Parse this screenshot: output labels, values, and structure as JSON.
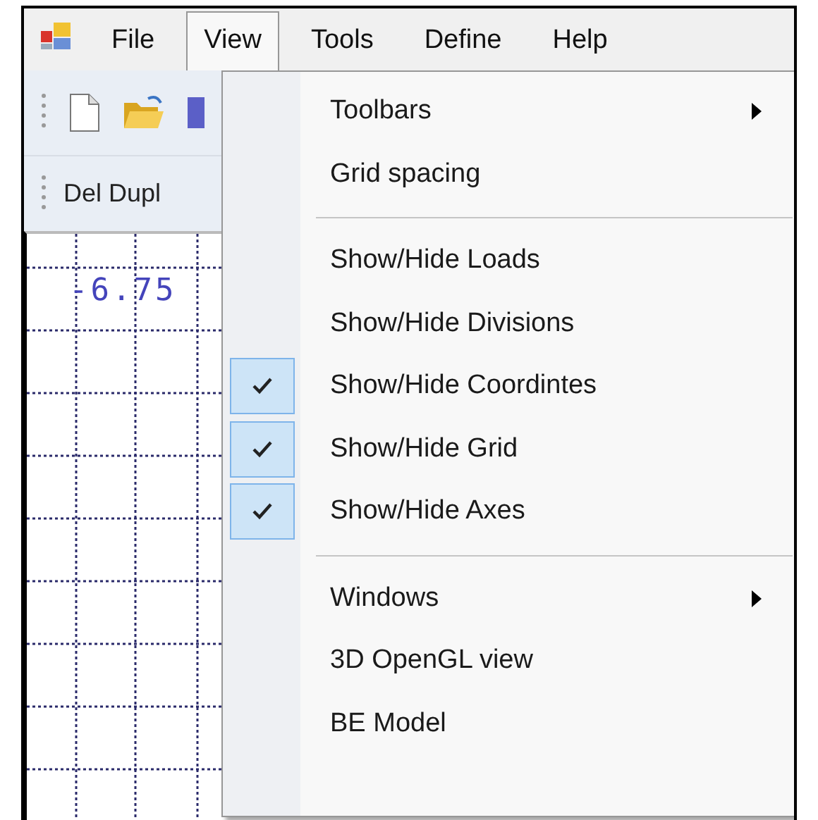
{
  "menu_bar": [
    {
      "label": "File",
      "selected": false
    },
    {
      "label": "View",
      "selected": true
    },
    {
      "label": "Tools",
      "selected": false
    },
    {
      "label": "Define",
      "selected": false
    },
    {
      "label": "Help",
      "selected": false
    }
  ],
  "toolbar_2": {
    "button": "Del Dupl"
  },
  "canvas": {
    "axis_label": "-6.75"
  },
  "view_menu": [
    {
      "kind": "item",
      "label": "Toolbars",
      "submenu": true,
      "checked": false
    },
    {
      "kind": "item",
      "label": "Grid spacing",
      "submenu": false,
      "checked": false
    },
    {
      "kind": "separator"
    },
    {
      "kind": "item",
      "label": "Show/Hide Loads",
      "submenu": false,
      "checked": false
    },
    {
      "kind": "item",
      "label": "Show/Hide Divisions",
      "submenu": false,
      "checked": false
    },
    {
      "kind": "item",
      "label": "Show/Hide Coordintes",
      "submenu": false,
      "checked": true
    },
    {
      "kind": "item",
      "label": "Show/Hide Grid",
      "submenu": false,
      "checked": true
    },
    {
      "kind": "item",
      "label": "Show/Hide Axes",
      "submenu": false,
      "checked": true
    },
    {
      "kind": "separator"
    },
    {
      "kind": "item",
      "label": "Windows",
      "submenu": true,
      "checked": false
    },
    {
      "kind": "item",
      "label": "3D OpenGL view",
      "submenu": false,
      "checked": false
    },
    {
      "kind": "item",
      "label": "BE Model",
      "submenu": false,
      "checked": false
    }
  ]
}
